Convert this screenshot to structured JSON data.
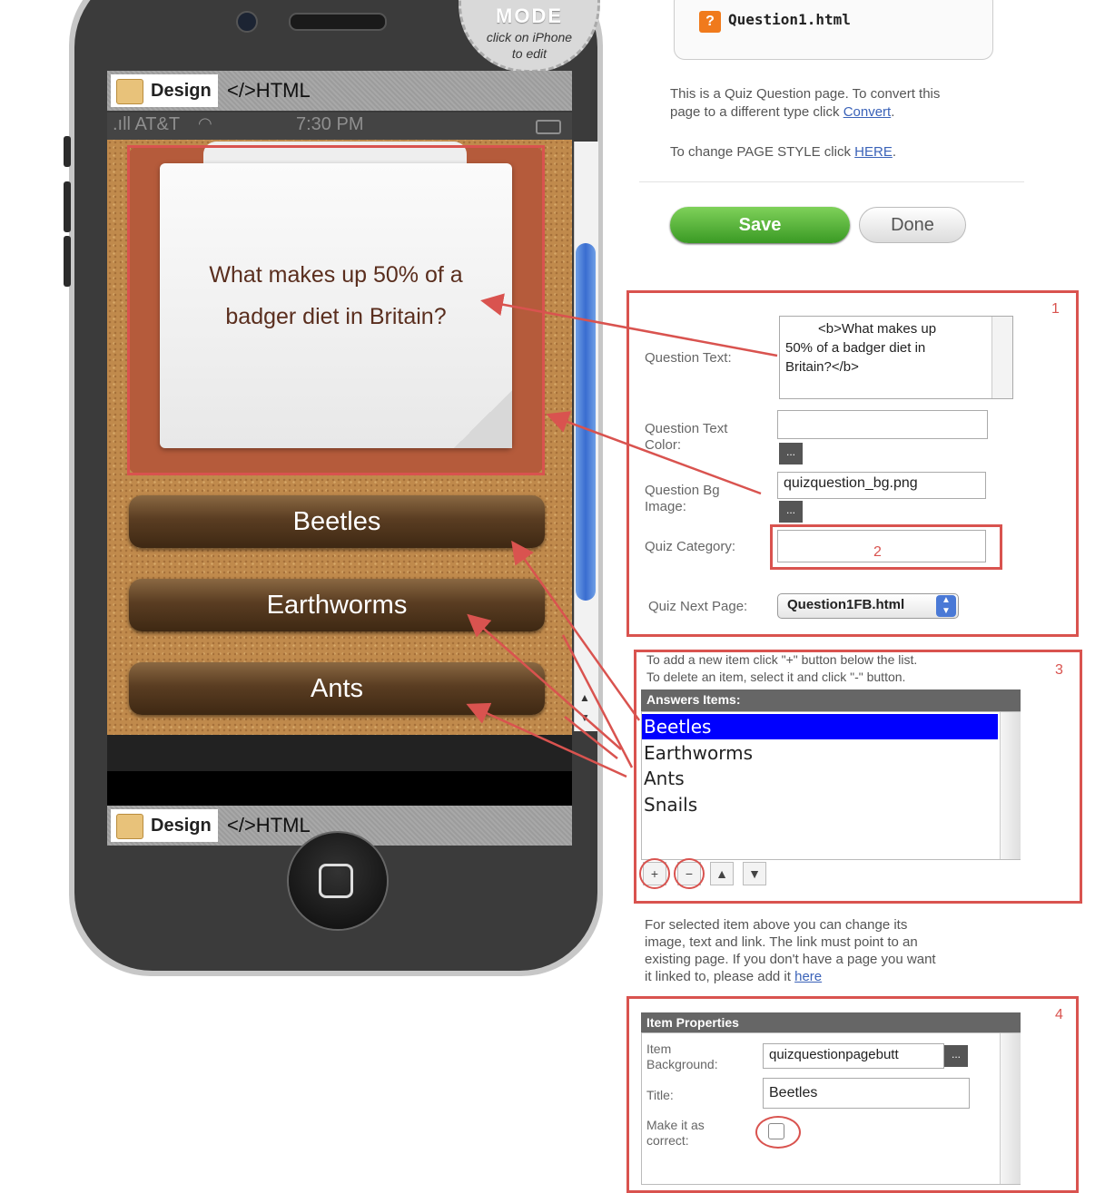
{
  "mode_badge": {
    "word": "MODE",
    "hint_line1": "click on iPhone",
    "hint_line2": "to edit"
  },
  "editor_bar": {
    "design_label": "Design",
    "html_label": "</>HTML"
  },
  "statusbar": {
    "carrier": ".ıll AT&T",
    "time": "7:30 PM"
  },
  "question": {
    "text_line1": "What makes up 50% of a",
    "text_line2": "badger diet in Britain?"
  },
  "answers": [
    "Beetles",
    "Earthworms",
    "Ants"
  ],
  "file": {
    "icon": "question-page-icon",
    "name": "Question1.html"
  },
  "info": {
    "convert_line1": "This is a Quiz Question page. To convert this",
    "convert_line2": "page to a different type click",
    "convert_link": "Convert",
    "style_text": "To change PAGE STYLE click",
    "style_link": "HERE"
  },
  "buttons": {
    "save": "Save",
    "done": "Done"
  },
  "form": {
    "question_text_label": "Question Text:",
    "question_text_value_line1": "<b>What makes up",
    "question_text_value_line2": "50% of a badger diet in",
    "question_text_value_line3": "Britain?</b>",
    "question_text_color_label_line1": "Question Text",
    "question_text_color_label_line2": "Color:",
    "question_text_color_value": "",
    "question_bg_label_line1": "Question Bg",
    "question_bg_label_line2": "Image:",
    "question_bg_value": "quizquestion_bg.png",
    "quiz_category_label": "Quiz Category:",
    "quiz_category_value": "",
    "quiz_next_label": "Quiz Next Page:",
    "quiz_next_value": "Question1FB.html",
    "dots": "..."
  },
  "answers_section": {
    "hint_line1": "To add a new item click \"+\" button below the list.",
    "hint_line2": "To delete an item, select it and click \"-\" button.",
    "header": "Answers Items:",
    "items": [
      "Beetles",
      "Earthworms",
      "Ants",
      "Snails"
    ],
    "selected_index": 0,
    "add": "+",
    "remove": "−",
    "up": "▲",
    "down": "▼"
  },
  "selected_info": {
    "line1": "For selected item above you can change its",
    "line2": "image, text and link. The link must point to an",
    "line3": "existing page. If you don't have a page you want",
    "line4": "it linked to, please add it",
    "link": "here"
  },
  "item_properties": {
    "header": "Item Properties",
    "bg_label_line1": "Item",
    "bg_label_line2": "Background:",
    "bg_value": "quizquestionpagebutt",
    "title_label": "Title:",
    "title_value": "Beetles",
    "correct_label_line1": "Make it as",
    "correct_label_line2": "correct:",
    "correct_checked": false
  },
  "annotations": {
    "box1": "1",
    "box2": "2",
    "box3": "3",
    "box4": "4"
  },
  "colors": {
    "annotation_red": "#d9534f",
    "save_green": "#3a9a24",
    "selection_blue": "#0000ff",
    "answer_brown": "#5a3d22"
  }
}
